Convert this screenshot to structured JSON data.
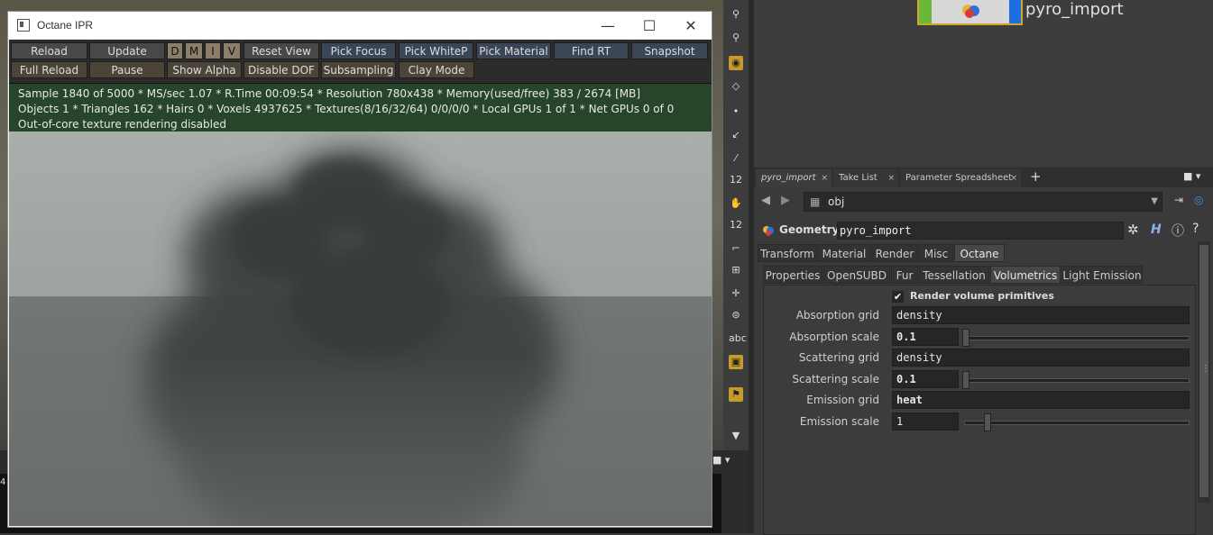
{
  "ipr": {
    "title": "Octane IPR",
    "window_buttons": {
      "minimize": "—",
      "maximize": "☐",
      "close": "✕"
    },
    "toolbar_row1": [
      "Reload",
      "Update",
      "D",
      "M",
      "I",
      "V",
      "Reset View",
      "Pick Focus",
      "Pick WhiteP",
      "Pick Material",
      "Find RT",
      "Snapshot"
    ],
    "toolbar_row2": [
      "Full Reload",
      "Pause",
      "Show Alpha",
      "Disable DOF",
      "Subsampling",
      "Clay Mode"
    ],
    "status": {
      "line1": "Sample 1840 of 5000 * MS/sec 1.07 * R.Time 00:09:54 * Resolution 780x438 * Memory(used/free) 383 / 2674 [MB]",
      "line2": "Objects 1 * Triangles 162 * Hairs 0 * Voxels 4937625 * Textures(8/16/32/64) 0/0/0/0 * Local GPUs 1 of 1 * Net GPUs 0 of 0",
      "line3": "Out-of-core texture rendering disabled"
    }
  },
  "network": {
    "node_name": "pyro_import"
  },
  "pane_tabs": [
    "pyro_import",
    "Take List",
    "Parameter Spreadsheet"
  ],
  "path": "obj",
  "geometry": {
    "label": "Geometry",
    "name": "pyro_import"
  },
  "main_tabs": [
    "Transform",
    "Material",
    "Render",
    "Misc",
    "Octane"
  ],
  "sub_tabs": [
    "Properties",
    "OpenSUBD",
    "Fur",
    "Tessellation",
    "Volumetrics",
    "Light Emission"
  ],
  "volumetrics": {
    "render_volume_label": "Render volume primitives",
    "render_volume_checked": true,
    "rows": [
      {
        "label": "Absorption grid",
        "value": "density"
      },
      {
        "label": "Absorption scale",
        "value": "0.1",
        "slider": 0.0
      },
      {
        "label": "Scattering grid",
        "value": "density"
      },
      {
        "label": "Scattering scale",
        "value": "0.1",
        "slider": 0.0
      },
      {
        "label": "Emission grid",
        "value": "heat"
      },
      {
        "label": "Emission scale",
        "value": "1",
        "slider": 0.1
      }
    ]
  },
  "shelf_labels": {
    "num1": "12",
    "num2": "12",
    "abc": "abc"
  },
  "bottom_left_text": "4"
}
